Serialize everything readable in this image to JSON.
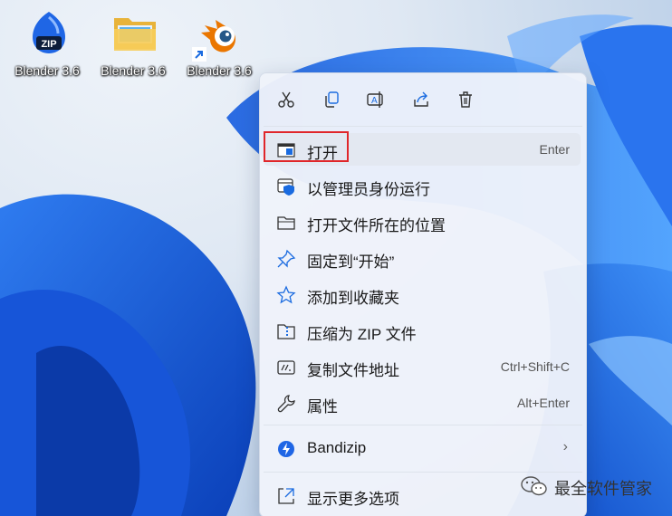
{
  "desktop": {
    "icons": [
      {
        "label": "Blender 3.6",
        "type": "zip-archive-icon"
      },
      {
        "label": "Blender 3.6",
        "type": "folder-icon"
      },
      {
        "label": "Blender 3.6",
        "type": "blender-app-icon"
      }
    ]
  },
  "context_menu": {
    "quick_actions": [
      {
        "name": "cut",
        "icon": "scissors-icon"
      },
      {
        "name": "copy",
        "icon": "copy-icon"
      },
      {
        "name": "rename",
        "icon": "rename-icon"
      },
      {
        "name": "share",
        "icon": "share-icon"
      },
      {
        "name": "delete",
        "icon": "trash-icon"
      }
    ],
    "items": [
      {
        "label": "打开",
        "shortcut": "Enter",
        "icon": "open-window-icon"
      },
      {
        "label": "以管理员身份运行",
        "shortcut": "",
        "icon": "run-as-admin-icon"
      },
      {
        "label": "打开文件所在的位置",
        "shortcut": "",
        "icon": "folder-outline-icon"
      },
      {
        "label": "固定到“开始”",
        "shortcut": "",
        "icon": "pin-icon"
      },
      {
        "label": "添加到收藏夹",
        "shortcut": "",
        "icon": "star-icon"
      },
      {
        "label": "压缩为 ZIP 文件",
        "shortcut": "",
        "icon": "zip-folder-icon"
      },
      {
        "label": "复制文件地址",
        "shortcut": "Ctrl+Shift+C",
        "icon": "copy-path-icon"
      },
      {
        "label": "属性",
        "shortcut": "Alt+Enter",
        "icon": "wrench-icon"
      }
    ],
    "bandizip": {
      "label": "Bandizip",
      "icon": "bandizip-icon"
    },
    "more": {
      "label": "显示更多选项",
      "icon": "more-options-icon"
    }
  },
  "watermark": {
    "text": "最全软件管家",
    "icon": "wechat-icon"
  },
  "colors": {
    "accent": "#0067c0",
    "highlight_border": "#e0262a"
  }
}
